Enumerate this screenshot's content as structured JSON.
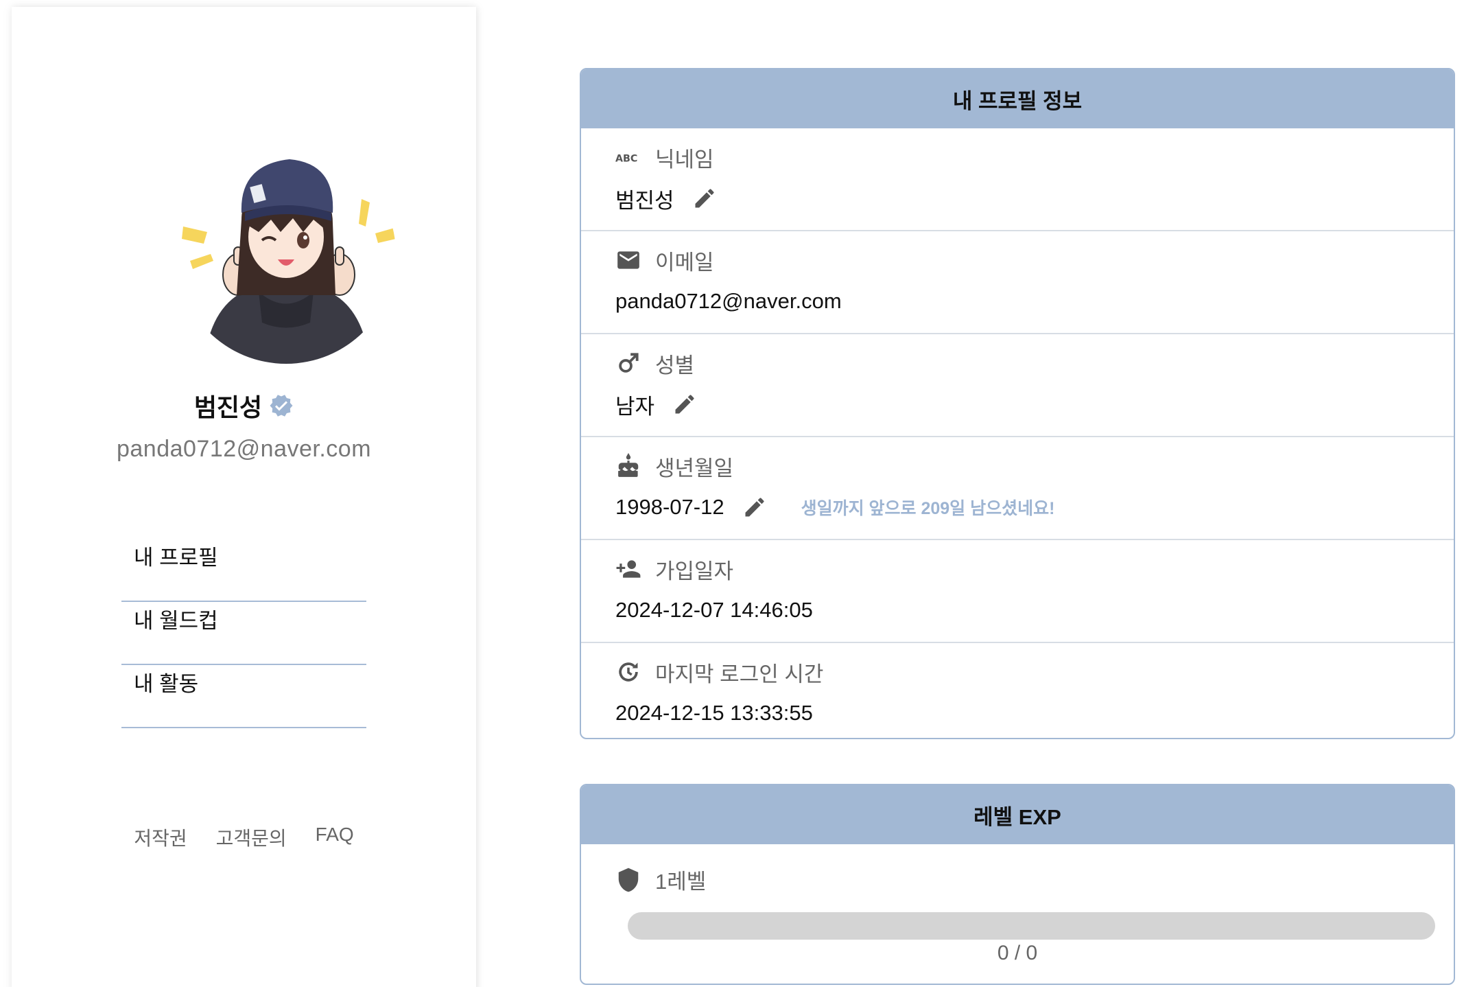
{
  "sidebar": {
    "name": "범진성",
    "email": "panda0712@naver.com",
    "menu": [
      "내 프로필",
      "내 월드컵",
      "내 활동"
    ],
    "footer": [
      "저작권",
      "고객문의",
      "FAQ"
    ]
  },
  "profile_card": {
    "title": "내 프로필 정보",
    "nickname": {
      "label": "닉네임",
      "value": "범진성",
      "icon": "abc-icon"
    },
    "email": {
      "label": "이메일",
      "value": "panda0712@naver.com",
      "icon": "mail-icon"
    },
    "gender": {
      "label": "성별",
      "value": "남자",
      "icon": "male-icon"
    },
    "birthday": {
      "label": "생년월일",
      "value": "1998-07-12",
      "note": "생일까지 앞으로 209일 남으셨네요!",
      "icon": "cake-icon"
    },
    "joined": {
      "label": "가입일자",
      "value": "2024-12-07 14:46:05",
      "icon": "person-add-icon"
    },
    "last_login": {
      "label": "마지막 로그인 시간",
      "value": "2024-12-15 13:33:55",
      "icon": "history-icon"
    }
  },
  "level_card": {
    "title": "레벨 EXP",
    "level_label": "1레벨",
    "progress_text": "0 / 0",
    "progress_fraction": 0,
    "icon": "shield-icon"
  },
  "colors": {
    "accent": "#a2b8d4",
    "note": "#9db4d2",
    "track": "#d4d4d4"
  }
}
